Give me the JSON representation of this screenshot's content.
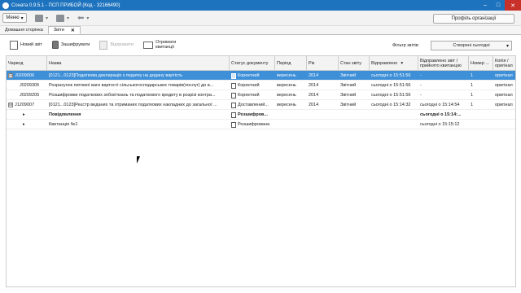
{
  "titlebar": {
    "title": "Соната 0.9.5.1 - ПСП ПРИБОЙ (Код - 32166490)"
  },
  "menubar": {
    "menu_label": "Меню",
    "profile_label": "Профіль організації"
  },
  "tabs": [
    {
      "label": "Домашня сторінка"
    },
    {
      "label": "Звіти"
    }
  ],
  "toolbar": {
    "new_report": "Новий звіт",
    "encrypt": "Зашифрувати",
    "send": "Відправити",
    "receive_line1": "Отримати",
    "receive_line2": "квитанції",
    "filter_label": "Фільтр звітів:",
    "filter_value": "Створені сьогодні"
  },
  "columns": {
    "code": "Чаркод",
    "name": "Назва",
    "status": "Статус документу",
    "period": "Період",
    "year": "Рік",
    "report_state": "Стан звіту",
    "sent": "Відправлено",
    "receipt_line1": "Відправлено звіт /",
    "receipt_line2": "прийнято квитанцію",
    "number": "Номер ...",
    "copy_line1": "Копія /",
    "copy_line2": "оригінал"
  },
  "rows": [
    {
      "expander": "⊟",
      "code": "J0209006",
      "name": "[0121...0123]Податкова декларація з податку на додану вартість",
      "status": "Коректний",
      "period": "вересень",
      "year": "2014",
      "state": "Звітний",
      "sent": "сьогодні о 15:51:56",
      "receipt": "-",
      "number": "1",
      "copy": "оригінал"
    },
    {
      "expander": "",
      "code": "J0209305",
      "name": "Розрахунок питомої ваги вартості сільськогосподарських товарів(послуг) до в...",
      "status": "Коректний",
      "period": "вересень",
      "year": "2014",
      "state": "Звітний",
      "sent": "сьогодні о 15:51:56",
      "receipt": "-",
      "number": "1",
      "copy": "оригінал"
    },
    {
      "expander": "",
      "code": "J0209205",
      "name": "Розшифровки податкових зобов'язань та податкового кредиту в розрізі контра...",
      "status": "Коректний",
      "period": "вересень",
      "year": "2014",
      "state": "Звітний",
      "sent": "сьогодні о 15:51:56",
      "receipt": "-",
      "number": "1",
      "copy": "оригінал"
    },
    {
      "expander": "⊟",
      "code": "J1209007",
      "name": "[0121...0123]Реєстр виданих та отриманих податкових накладних до загальної ...",
      "status": "Доставлений...",
      "period": "вересень",
      "year": "2014",
      "state": "Звітний",
      "sent": "сьогодні о 15:14:32",
      "receipt": "сьогодні о 15:14:54",
      "number": "1",
      "copy": "оригінал"
    },
    {
      "expander": "▸",
      "code": "",
      "name": "Повідомлення",
      "status": "Розшифров...",
      "period": "",
      "year": "",
      "state": "",
      "sent": "",
      "receipt": "сьогодні о 15:14:...",
      "number": "",
      "copy": ""
    },
    {
      "expander": "▸",
      "code": "",
      "name": "Квитанція №1",
      "status": "Розшифрована",
      "period": "",
      "year": "",
      "state": "",
      "sent": "",
      "receipt": "сьогодні о 15:15:12",
      "number": "",
      "copy": ""
    }
  ]
}
